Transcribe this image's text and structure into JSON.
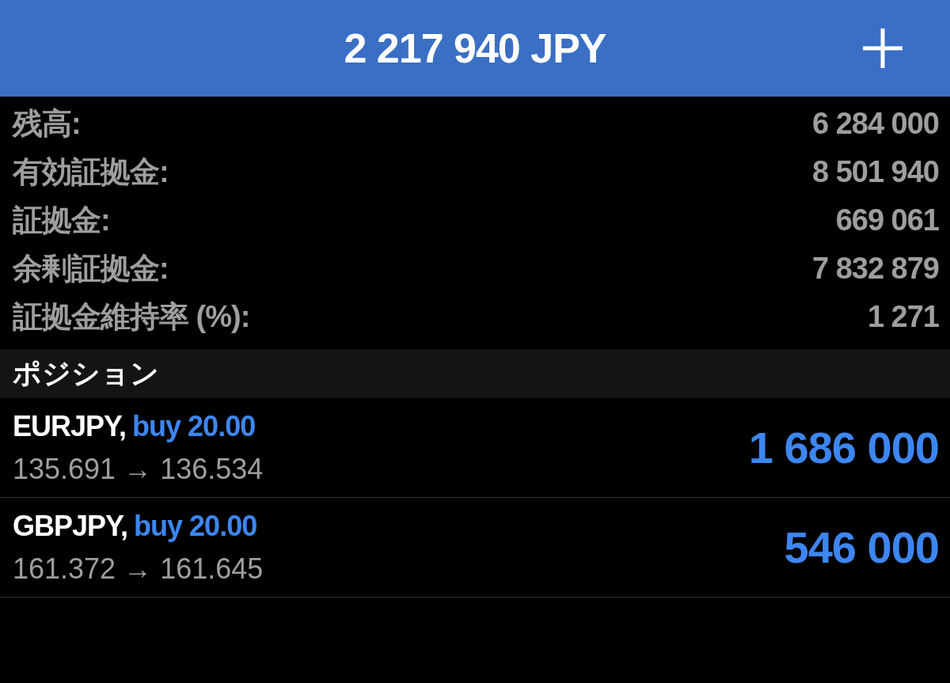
{
  "header": {
    "title": "2 217 940 JPY"
  },
  "summary": [
    {
      "label": "残高:",
      "value": "6 284 000"
    },
    {
      "label": "有効証拠金:",
      "value": "8 501 940"
    },
    {
      "label": "証拠金:",
      "value": "669 061"
    },
    {
      "label": "余剰証拠金:",
      "value": "7 832 879"
    },
    {
      "label": "証拠金維持率 (%):",
      "value": "1 271"
    }
  ],
  "positions_section": {
    "title": "ポジション"
  },
  "positions": [
    {
      "symbol": "EURJPY,",
      "side": "buy 20.00",
      "prices": "135.691 → 136.534",
      "profit": "1 686 000"
    },
    {
      "symbol": "GBPJPY,",
      "side": "buy 20.00",
      "prices": "161.372 → 161.645",
      "profit": "546 000"
    }
  ]
}
